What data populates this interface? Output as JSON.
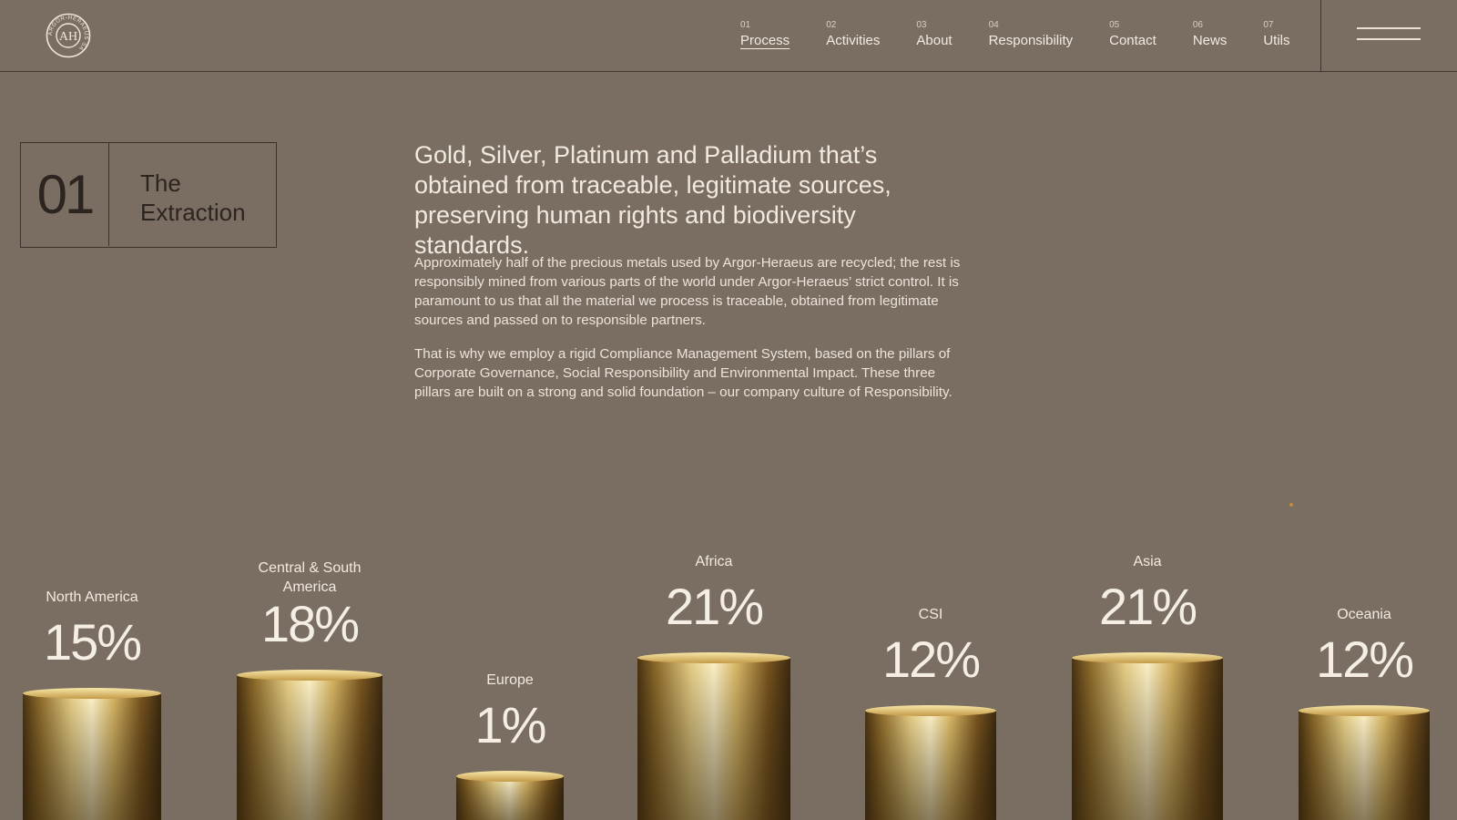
{
  "header": {
    "logo_text": "ARGOR-HERAEUS SA",
    "nav": [
      {
        "num": "01",
        "label": "Process",
        "active": true
      },
      {
        "num": "02",
        "label": "Activities"
      },
      {
        "num": "03",
        "label": "About"
      },
      {
        "num": "04",
        "label": "Responsibility"
      },
      {
        "num": "05",
        "label": "Contact"
      },
      {
        "num": "06",
        "label": "News"
      },
      {
        "num": "07",
        "label": "Utils"
      }
    ]
  },
  "section": {
    "number": "01",
    "title_line1": "The",
    "title_line2": "Extraction"
  },
  "content": {
    "headline": "Gold, Silver, Platinum and Palladium that’s obtained from traceable, legitimate sources, preserving human rights and biodiversity standards.",
    "paragraph1": "Approximately half of the precious metals used by Argor-Heraeus are recycled; the rest is responsibly mined from various parts of the world under Argor-Heraeus’ strict control. It is paramount to us that all the material we process is traceable, obtained from legitimate sources and passed on to responsible partners.",
    "paragraph2": "That is why we employ a rigid Compliance Management System, based on the pillars of Corporate Governance, Social Responsibility and Environmental Impact. These three pillars are built on a strong and solid foundation – our company culture of Responsibility."
  },
  "regions": [
    {
      "name": "North America",
      "percent": "15%",
      "value": 15
    },
    {
      "name": "Central & South America",
      "percent": "18%",
      "value": 18
    },
    {
      "name": "Europe",
      "percent": "1%",
      "value": 1
    },
    {
      "name": "Africa",
      "percent": "21%",
      "value": 21
    },
    {
      "name": "CSI",
      "percent": "12%",
      "value": 12
    },
    {
      "name": "Asia",
      "percent": "21%",
      "value": 21
    },
    {
      "name": "Oceania",
      "percent": "12%",
      "value": 12
    }
  ],
  "colors": {
    "background": "#7a6e63",
    "gold_light": "#f6e3a0",
    "gold_dark": "#3c2a10"
  }
}
